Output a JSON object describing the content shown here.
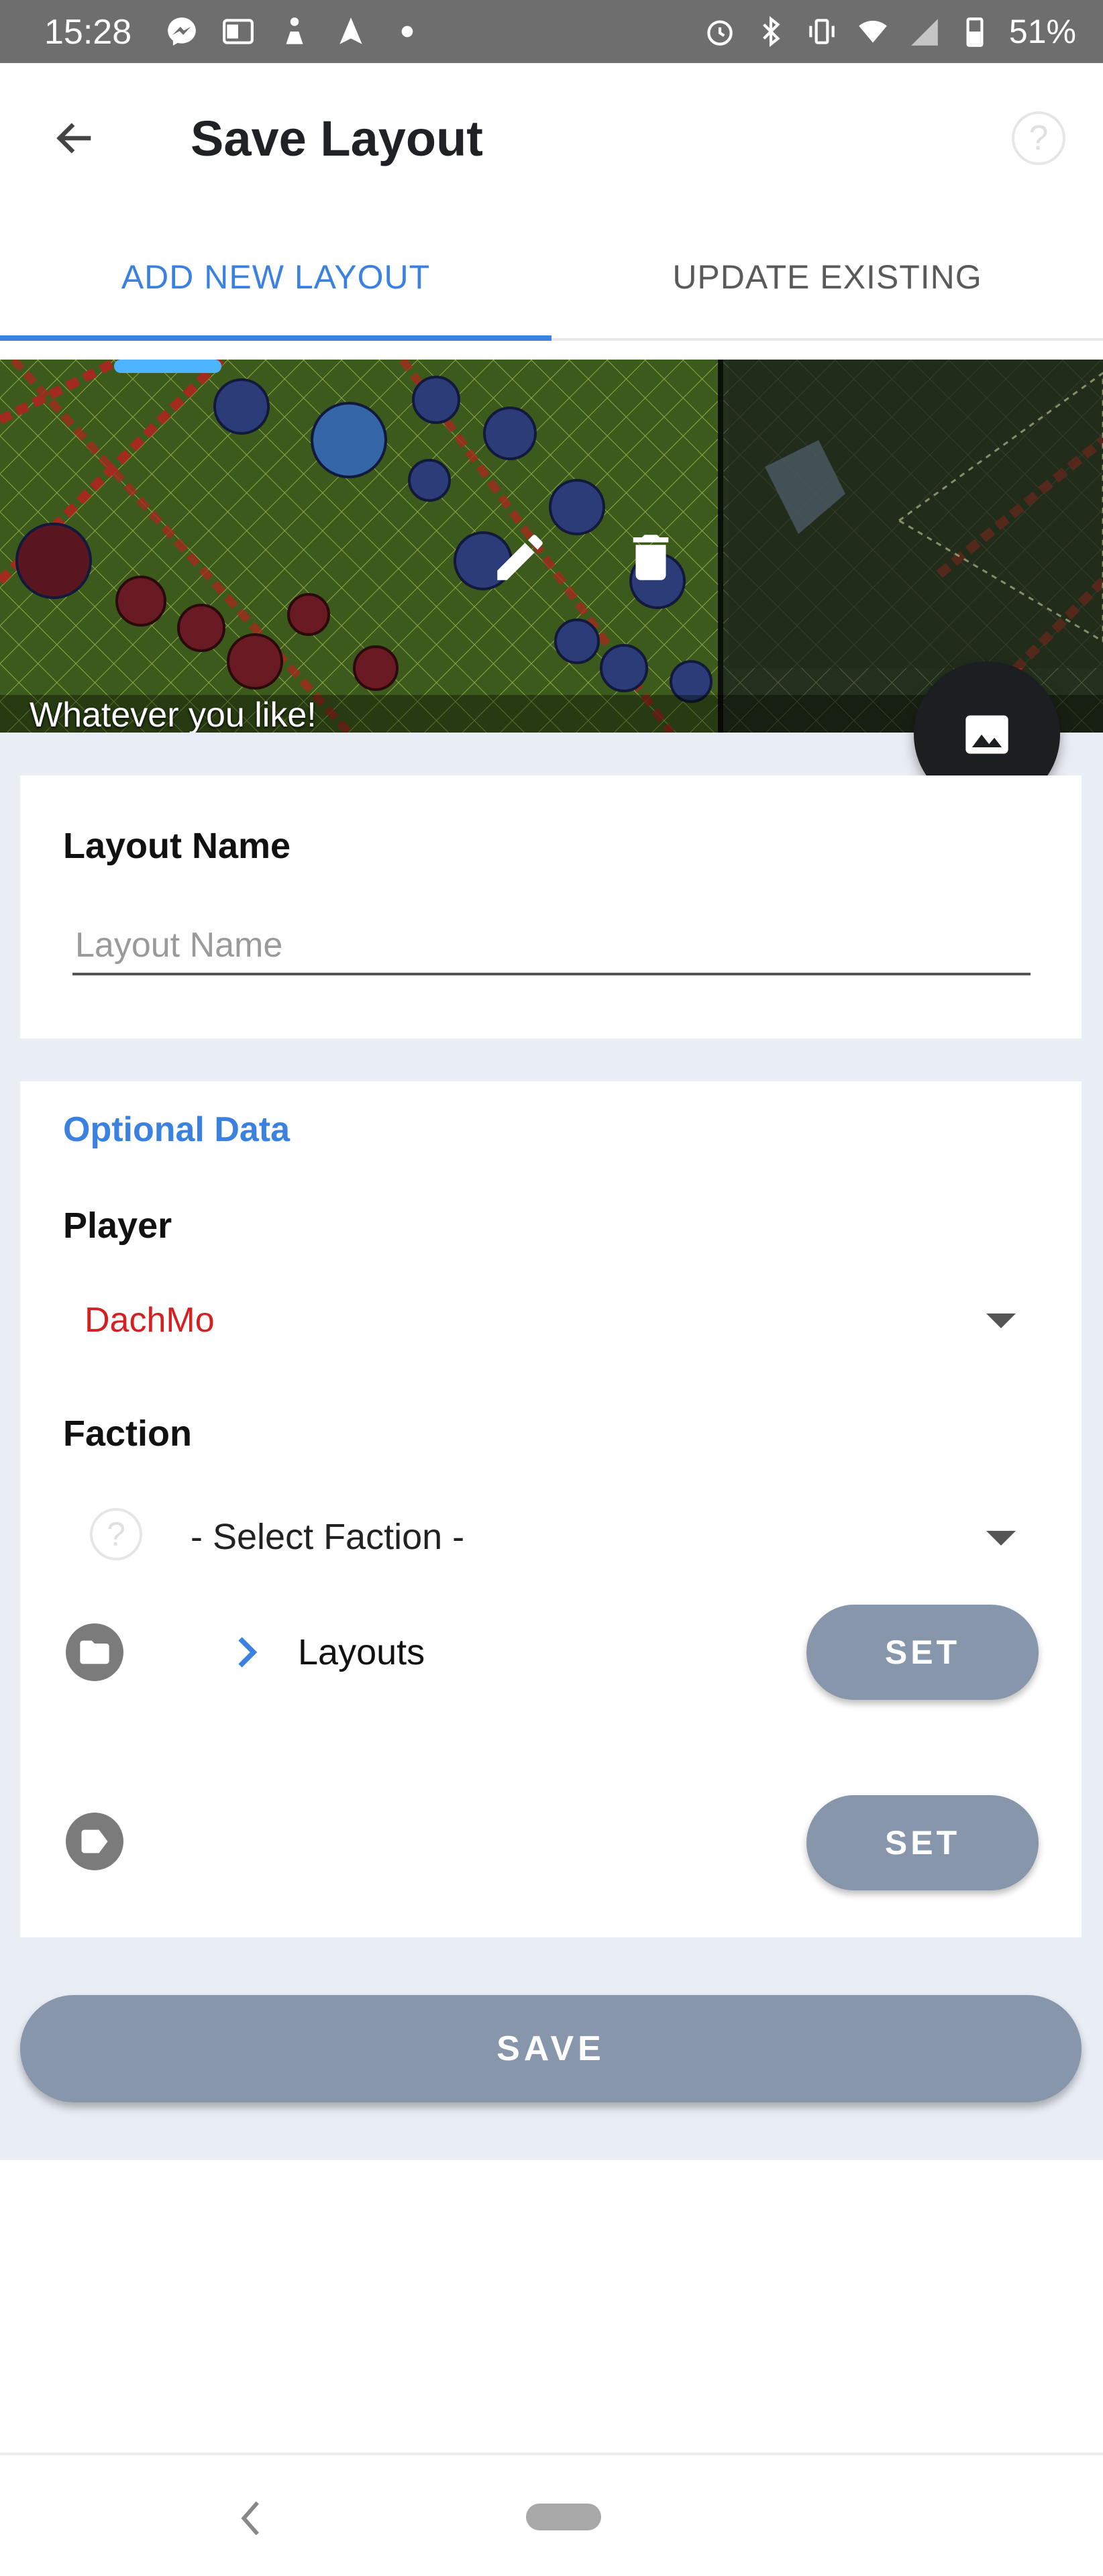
{
  "status_bar": {
    "time": "15:28",
    "battery": "51%",
    "left_icons": [
      "messenger-icon",
      "outlook-icon",
      "app-icon",
      "navigation-icon",
      "dot-icon"
    ],
    "right_icons": [
      "alarm-icon",
      "bluetooth-icon",
      "vibrate-icon",
      "wifi-icon",
      "signal-icon",
      "battery-icon"
    ]
  },
  "app_bar": {
    "title": "Save Layout",
    "help": "?"
  },
  "tabs": [
    {
      "label": "ADD NEW LAYOUT",
      "active": true
    },
    {
      "label": "UPDATE EXISTING",
      "active": false
    }
  ],
  "layout_image": {
    "caption": "Whatever you like!"
  },
  "form": {
    "layout_name": {
      "label": "Layout Name",
      "placeholder": "Layout Name",
      "value": ""
    },
    "optional": {
      "title": "Optional Data",
      "player_label": "Player",
      "player_value": "DachMo",
      "faction_label": "Faction",
      "faction_help": "?",
      "faction_value": "- Select Faction -",
      "folder_label": "Layouts",
      "set_label_1": "SET",
      "set_label_2": "SET"
    },
    "save_label": "SAVE"
  },
  "colors": {
    "accent": "#3b82e0",
    "player_text": "#d42020",
    "button": "#8796aa",
    "fab": "#1c1f22"
  }
}
